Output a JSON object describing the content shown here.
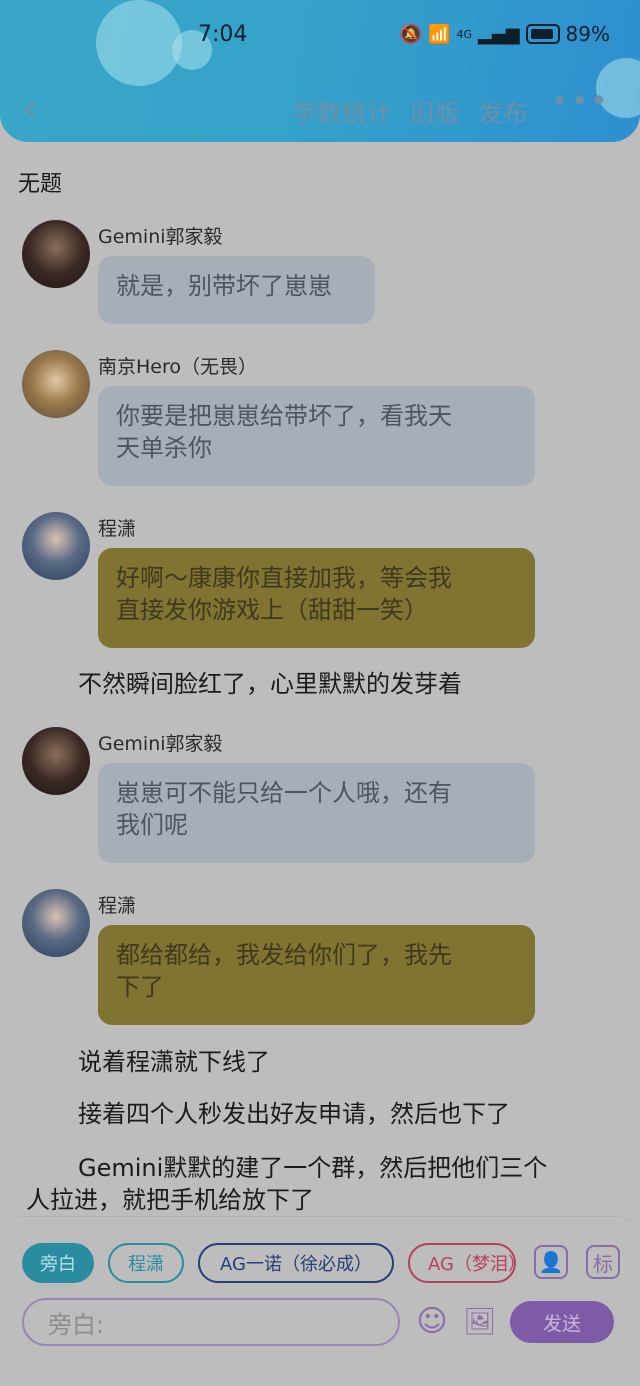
{
  "status": {
    "time": "7:04",
    "battery": "89%",
    "signal_label": "4G"
  },
  "header": {
    "back_icon": "chevron-left-icon",
    "links": [
      "字数统计",
      "旧版",
      "发布"
    ],
    "more": "•••"
  },
  "title": "无题",
  "messages": [
    {
      "type": "chat",
      "name": "Gemini郭家毅",
      "lines": [
        "就是，别带坏了崽崽"
      ],
      "style": "gray"
    },
    {
      "type": "chat",
      "name": "南京Hero（无畏）",
      "lines": [
        "你要是把崽崽给带坏了，看我天",
        "天单杀你"
      ],
      "style": "gray"
    },
    {
      "type": "chat",
      "name": "程潇",
      "lines": [
        "好啊～康康你直接加我，等会我",
        "直接发你游戏上（甜甜一笑）"
      ],
      "style": "gold"
    },
    {
      "type": "narration",
      "text": "不然瞬间脸红了，心里默默的发芽着"
    },
    {
      "type": "chat",
      "name": "Gemini郭家毅",
      "lines": [
        "崽崽可不能只给一个人哦，还有",
        "我们呢"
      ],
      "style": "gray"
    },
    {
      "type": "chat",
      "name": "程潇",
      "lines": [
        "都给都给，我发给你们了，我先",
        "下了"
      ],
      "style": "gold"
    },
    {
      "type": "narration",
      "text": "说着程潇就下线了"
    },
    {
      "type": "narration",
      "text": "接着四个人秒发出好友申请，然后也下了"
    },
    {
      "type": "narration",
      "lines": [
        "Gemini默默的建了一个群，然后把他们三个",
        "人拉进，就把手机给放下了"
      ]
    }
  ],
  "roles": [
    "旁白",
    "程潇",
    "AG一诺（徐必成）",
    "AG（梦泪）"
  ],
  "role_buttons": {
    "person": "👤",
    "mark": "标"
  },
  "input": {
    "placeholder": "旁白:"
  },
  "tools": {
    "emoji": "☺",
    "image": "🖼"
  },
  "send_label": "发送"
}
